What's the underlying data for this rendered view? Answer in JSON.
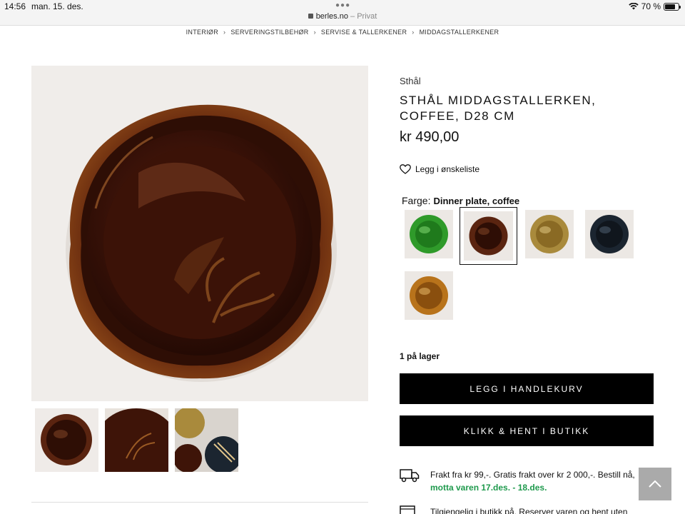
{
  "status": {
    "time": "14:56",
    "date": "man. 15. des.",
    "battery": "70 %"
  },
  "browser": {
    "domain": "berles.no",
    "mode": "– Privat"
  },
  "breadcrumb": [
    "INTERIØR",
    "SERVERINGSTILBEHØR",
    "SERVISE & TALLERKENER",
    "MIDDAGSTALLERKENER"
  ],
  "product": {
    "brand": "Sthål",
    "title": "STHÅL MIDDAGSTALLERKEN, COFFEE, D28 CM",
    "price": "kr 490,00",
    "wishlist_label": "Legg i ønskeliste",
    "color_label": "Farge:",
    "color_value": "Dinner plate, coffee",
    "swatches": [
      {
        "name": "green",
        "color": "#2f9a2a"
      },
      {
        "name": "coffee",
        "color": "#4a1c0c",
        "selected": true
      },
      {
        "name": "amber-olive",
        "color": "#a98a3c"
      },
      {
        "name": "dark-blue",
        "color": "#1b2530"
      },
      {
        "name": "amber",
        "color": "#b8731b"
      }
    ],
    "stock": "1 på lager",
    "add_to_cart": "LEGG I HANDLEKURV",
    "click_collect": "KLIKK & HENT I BUTIKK",
    "shipping_text": "Frakt fra kr 99,-. Gratis frakt over kr 2 000,-. Bestill nå,",
    "shipping_delivery": "motta varen 17.des. - 18.des.",
    "store_text": "Tilgjengelig i butikk på. Reserver varen og hent uten"
  },
  "colors": {
    "accent_green": "#1f9a4d",
    "button_bg": "#000000",
    "plate_brown": "#3d150a"
  }
}
